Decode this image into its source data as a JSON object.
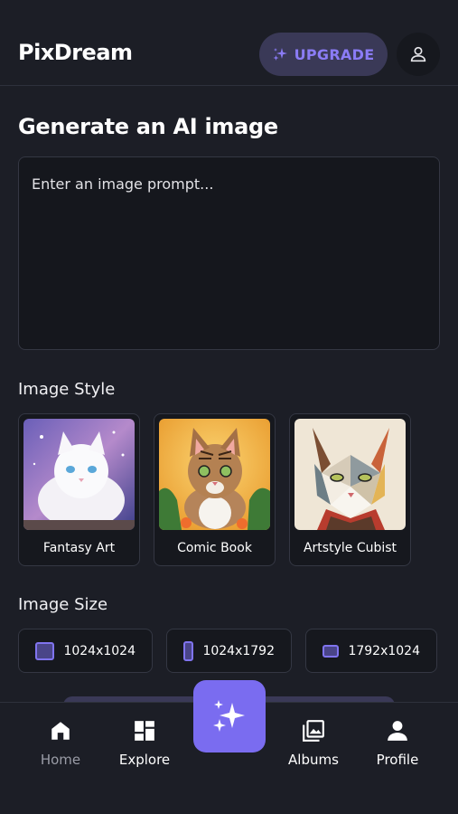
{
  "app": {
    "name": "PixDream"
  },
  "header": {
    "upgrade_label": "UPGRADE"
  },
  "main": {
    "title": "Generate an AI image",
    "prompt_placeholder": "Enter an image prompt...",
    "style_section": "Image Style",
    "styles": [
      {
        "label": "Fantasy Art"
      },
      {
        "label": "Comic Book"
      },
      {
        "label": "Artstyle Cubist"
      }
    ],
    "size_section": "Image Size",
    "sizes": [
      {
        "label": "1024x1024"
      },
      {
        "label": "1024x1792"
      },
      {
        "label": "1792x1024"
      }
    ]
  },
  "nav": {
    "items": [
      {
        "label": "Home",
        "icon": "home-icon"
      },
      {
        "label": "Explore",
        "icon": "explore-icon"
      },
      {
        "label": "Albums",
        "icon": "albums-icon"
      },
      {
        "label": "Profile",
        "icon": "profile-icon"
      }
    ]
  },
  "colors": {
    "accent": "#7a6cf0",
    "background": "#1c1e26",
    "upgrade_bg": "#3a3957"
  }
}
